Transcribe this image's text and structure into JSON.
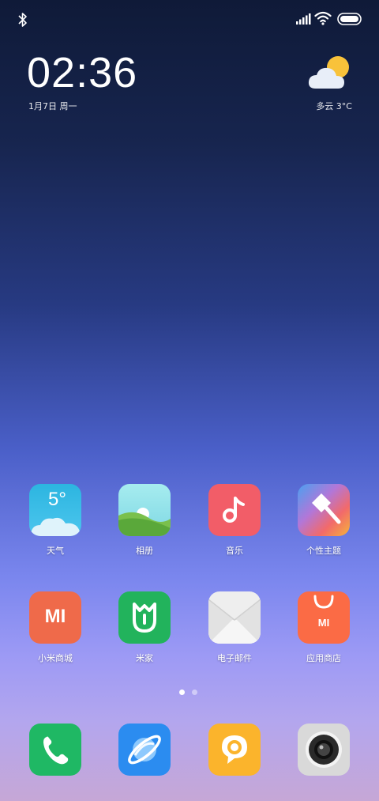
{
  "clock": {
    "time": "02:36",
    "date": "1月7日 周一"
  },
  "weather": {
    "summary": "多云  3°C",
    "icon": "partly-cloudy-icon"
  },
  "apps": [
    {
      "label": "天气",
      "icon": "weather-app-icon",
      "temp": "5°"
    },
    {
      "label": "相册",
      "icon": "gallery-icon"
    },
    {
      "label": "音乐",
      "icon": "music-icon"
    },
    {
      "label": "个性主题",
      "icon": "themes-icon"
    },
    {
      "label": "小米商城",
      "icon": "mi-store-icon",
      "mark": "MI"
    },
    {
      "label": "米家",
      "icon": "mi-home-icon"
    },
    {
      "label": "电子邮件",
      "icon": "email-icon"
    },
    {
      "label": "应用商店",
      "icon": "app-store-icon",
      "mark": "MI"
    }
  ],
  "dock": [
    {
      "icon": "phone-icon"
    },
    {
      "icon": "browser-icon"
    },
    {
      "icon": "messages-icon"
    },
    {
      "icon": "camera-icon"
    }
  ],
  "colors": {
    "weather_app": "#38b9e6",
    "music": "#f25d68",
    "mi_store": "#ef6a4a",
    "mi_home": "#22b35c",
    "app_store": "#fb6b45",
    "phone": "#1fb864",
    "browser": "#2b8cf0",
    "messages": "#fbb42c",
    "camera": "#d9d9d9"
  }
}
